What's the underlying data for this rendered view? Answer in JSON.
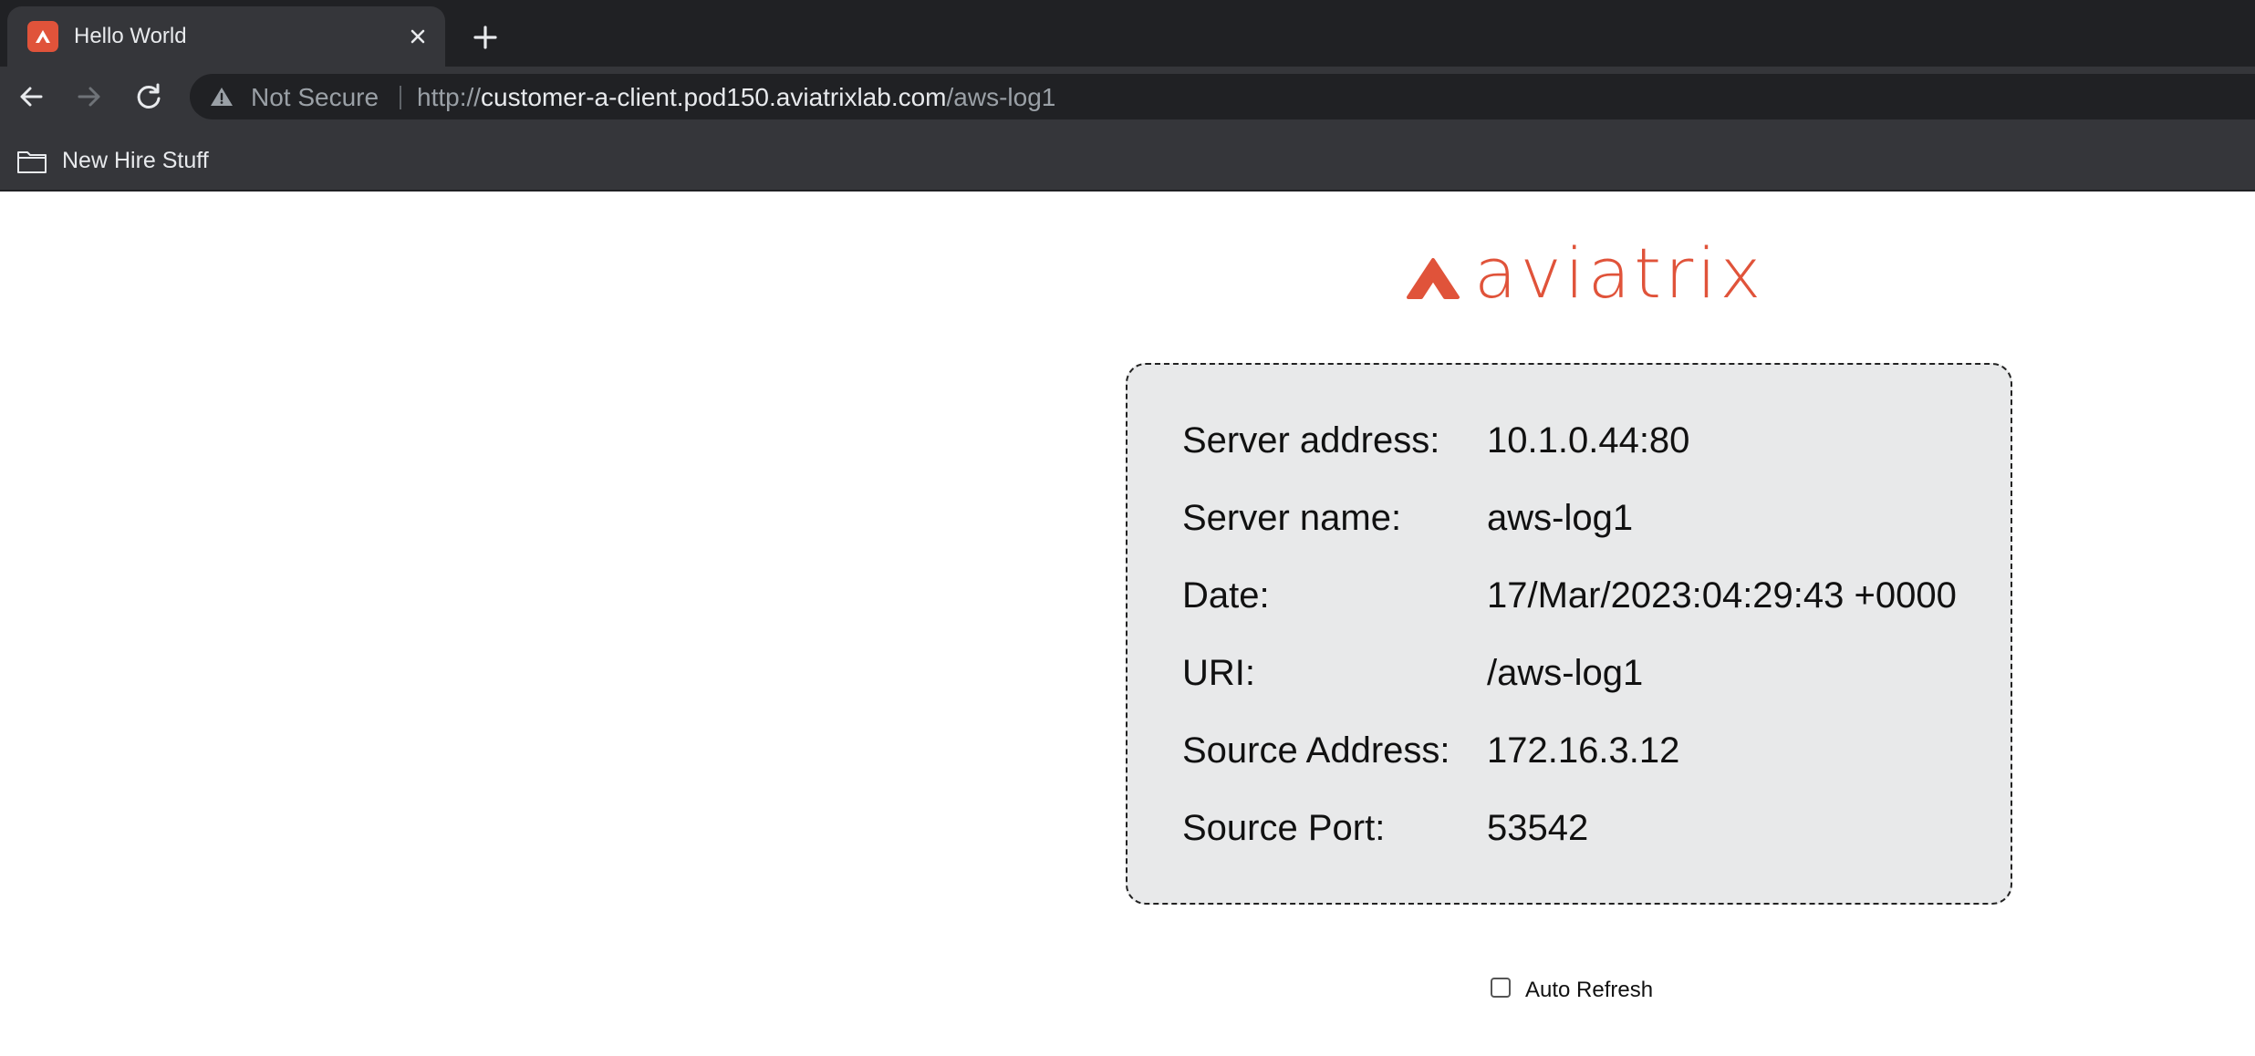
{
  "browser": {
    "tab": {
      "title": "Hello World"
    },
    "address_bar": {
      "security_label": "Not Secure",
      "url_scheme": "http://",
      "url_host": "customer-a-client.pod150.aviatrixlab.com",
      "url_path": "/aws-log1"
    },
    "bookmarks": [
      {
        "label": "New Hire Stuff",
        "icon": "folder-icon"
      }
    ]
  },
  "page": {
    "logo": {
      "text": "aviatrix",
      "color": "#e0533a"
    },
    "info": [
      {
        "label": "Server address:",
        "value": "10.1.0.44:80"
      },
      {
        "label": "Server name:",
        "value": "aws-log1"
      },
      {
        "label": "Date:",
        "value": "17/Mar/2023:04:29:43 +0000"
      },
      {
        "label": "URI:",
        "value": "/aws-log1"
      },
      {
        "label": "Source Address:",
        "value": "172.16.3.12"
      },
      {
        "label": "Source Port:",
        "value": "53542"
      }
    ],
    "auto_refresh": {
      "label": "Auto Refresh",
      "checked": false
    }
  },
  "colors": {
    "accent": "#e0533a",
    "chrome_dark": "#202124",
    "chrome": "#35363a",
    "info_box_bg": "#e8e9ea"
  }
}
